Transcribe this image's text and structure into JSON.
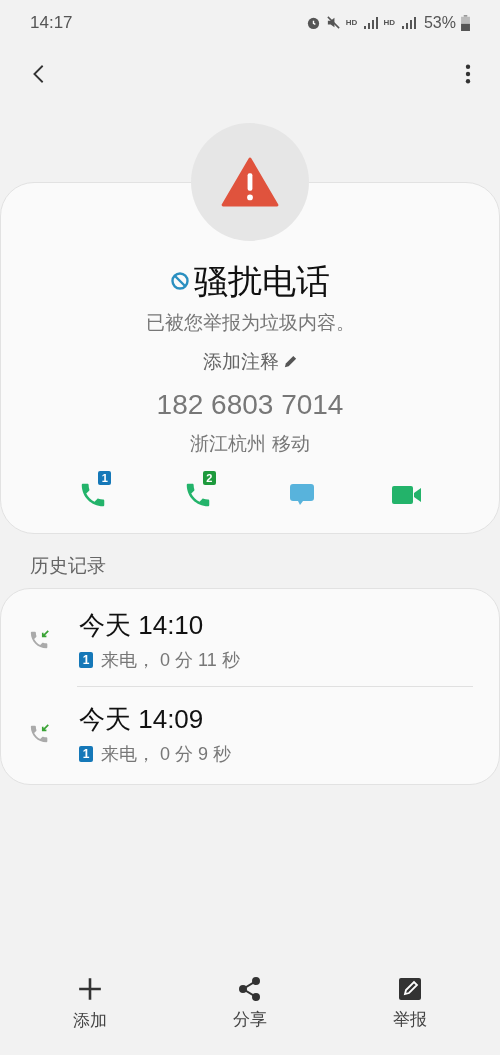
{
  "status_bar": {
    "time": "14:17",
    "indicators": [
      "HD",
      "HD"
    ],
    "battery": "53%"
  },
  "contact": {
    "name": "骚扰电话",
    "note": "已被您举报为垃圾内容。",
    "add_note": "添加注释",
    "number": "182 6803 7014",
    "location": "浙江杭州 移动"
  },
  "actions": [
    {
      "kind": "call",
      "sim": "1",
      "color": "#1578b8"
    },
    {
      "kind": "call",
      "sim": "2",
      "color": "#1d9a3c"
    },
    {
      "kind": "message"
    },
    {
      "kind": "video"
    }
  ],
  "history": {
    "title": "历史记录",
    "entries": [
      {
        "time": "今天 14:10",
        "sim": "1",
        "detail": "来电， 0 分 11 秒"
      },
      {
        "time": "今天 14:09",
        "sim": "1",
        "detail": "来电， 0 分 9 秒"
      }
    ]
  },
  "bottom_bar": [
    {
      "kind": "add",
      "label": "添加"
    },
    {
      "kind": "share",
      "label": "分享"
    },
    {
      "kind": "report",
      "label": "举报"
    }
  ]
}
